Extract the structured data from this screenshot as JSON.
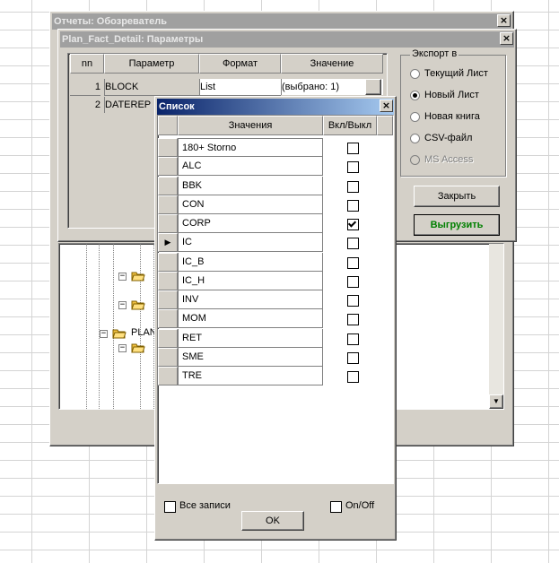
{
  "observer_window": {
    "title": "Отчеты: Обозреватель",
    "close_glyph": "×"
  },
  "params_window": {
    "title": "Plan_Fact_Detail: Параметры",
    "close_glyph": "×",
    "columns": [
      "nn",
      "Параметр",
      "Формат",
      "Значение"
    ],
    "rows": [
      {
        "nn": "1",
        "param": "BLOCK",
        "format": "List",
        "value": "(выбрано: 1)"
      },
      {
        "nn": "2",
        "param": "DATEREP",
        "format": "",
        "value": ""
      }
    ],
    "export": {
      "legend": "Экспорт в",
      "options": [
        {
          "label": "Текущий Лист",
          "selected": false,
          "enabled": true
        },
        {
          "label": "Новый Лист",
          "selected": true,
          "enabled": true
        },
        {
          "label": "Новая книга",
          "selected": false,
          "enabled": true
        },
        {
          "label": "CSV-файл",
          "selected": false,
          "enabled": true
        },
        {
          "label": "MS Access",
          "selected": false,
          "enabled": false
        }
      ]
    },
    "close_button": "Закрыть",
    "export_button": "Выгрузить",
    "export_button_color": "#008000"
  },
  "tree": {
    "labels": [
      "PLAN"
    ]
  },
  "list_dialog": {
    "title": "Список",
    "close_glyph": "×",
    "columns": [
      "Значения",
      "Вкл/Выкл"
    ],
    "current_row": 5,
    "items": [
      {
        "label": "180+ Storno",
        "checked": false
      },
      {
        "label": "ALC",
        "checked": false
      },
      {
        "label": "BBK",
        "checked": false
      },
      {
        "label": "CON",
        "checked": false
      },
      {
        "label": "CORP",
        "checked": true
      },
      {
        "label": "IC",
        "checked": false
      },
      {
        "label": "IC_B",
        "checked": false
      },
      {
        "label": "IC_H",
        "checked": false
      },
      {
        "label": "INV",
        "checked": false
      },
      {
        "label": "MOM",
        "checked": false
      },
      {
        "label": "RET",
        "checked": false
      },
      {
        "label": "SME",
        "checked": false
      },
      {
        "label": "TRE",
        "checked": false
      }
    ],
    "all_records_label": "Все записи",
    "onoff_label": "On/Off",
    "ok_button": "OK"
  }
}
